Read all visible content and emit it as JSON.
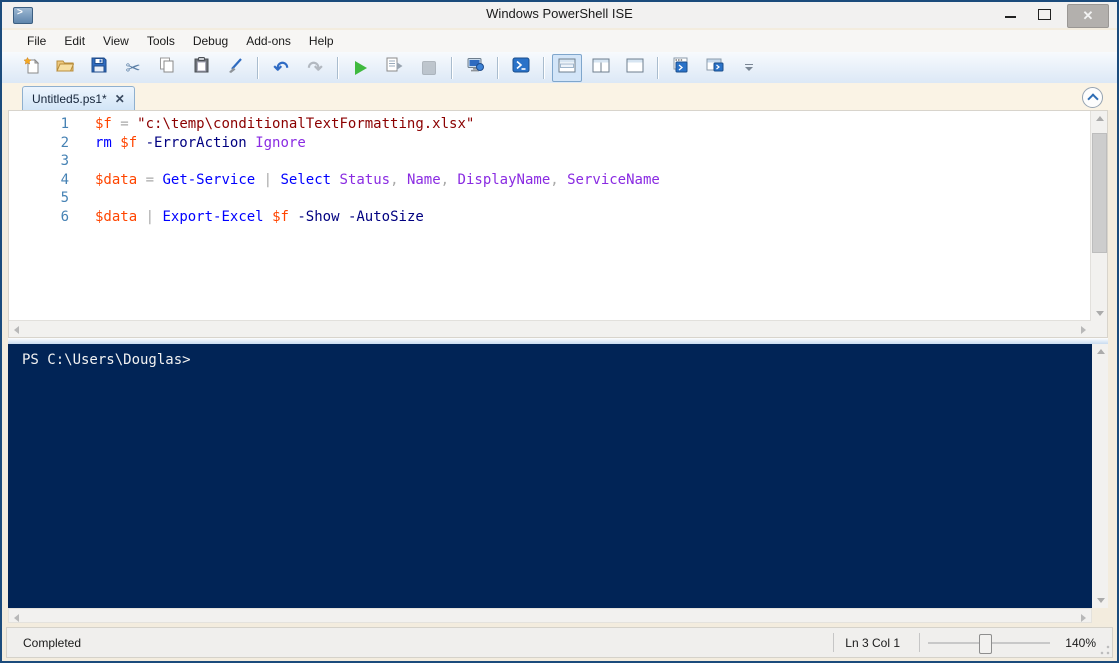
{
  "window": {
    "title": "Windows PowerShell ISE",
    "controls": {
      "minimize": "minimize",
      "maximize": "maximize",
      "close": "✕"
    }
  },
  "menu": {
    "items": [
      "File",
      "Edit",
      "View",
      "Tools",
      "Debug",
      "Add-ons",
      "Help"
    ]
  },
  "toolbar": {
    "icons": [
      "new-script-icon",
      "open-folder-icon",
      "save-icon",
      "scissors-cut-icon",
      "copy-icon",
      "paste-clipboard-icon",
      "clear-console-icon",
      "undo-arrow-icon",
      "redo-arrow-icon",
      "run-script-play-icon",
      "run-selection-icon",
      "stop-operation-icon",
      "new-remote-powershell-tab-icon",
      "start-powershell-icon",
      "script-pane-top-layout-icon",
      "script-pane-right-layout-icon",
      "script-pane-maximized-layout-icon",
      "new-powershell-tab-icon",
      "powershell-window-icon",
      "toolbar-overflow-icon"
    ],
    "selected_layout": "script-pane-top"
  },
  "tab": {
    "label": "Untitled5.ps1*",
    "close_glyph": "✕"
  },
  "editor": {
    "lines": [
      {
        "num": "1",
        "tokens": [
          {
            "t": "$f",
            "c": "variable"
          },
          {
            "t": " ",
            "c": "plain"
          },
          {
            "t": "=",
            "c": "operator"
          },
          {
            "t": " ",
            "c": "plain"
          },
          {
            "t": "\"c:\\temp\\conditionalTextFormatting.xlsx\"",
            "c": "string"
          }
        ]
      },
      {
        "num": "2",
        "tokens": [
          {
            "t": "rm",
            "c": "command"
          },
          {
            "t": " ",
            "c": "plain"
          },
          {
            "t": "$f",
            "c": "variable"
          },
          {
            "t": " ",
            "c": "plain"
          },
          {
            "t": "-ErrorAction",
            "c": "parameter"
          },
          {
            "t": " ",
            "c": "plain"
          },
          {
            "t": "Ignore",
            "c": "argument"
          }
        ]
      },
      {
        "num": "3",
        "tokens": []
      },
      {
        "num": "4",
        "tokens": [
          {
            "t": "$data",
            "c": "variable"
          },
          {
            "t": " ",
            "c": "plain"
          },
          {
            "t": "=",
            "c": "operator"
          },
          {
            "t": " ",
            "c": "plain"
          },
          {
            "t": "Get-Service",
            "c": "command"
          },
          {
            "t": " ",
            "c": "plain"
          },
          {
            "t": "|",
            "c": "operator"
          },
          {
            "t": " ",
            "c": "plain"
          },
          {
            "t": "Select",
            "c": "command"
          },
          {
            "t": " ",
            "c": "plain"
          },
          {
            "t": "Status",
            "c": "argument"
          },
          {
            "t": ", ",
            "c": "operator"
          },
          {
            "t": "Name",
            "c": "argument"
          },
          {
            "t": ", ",
            "c": "operator"
          },
          {
            "t": "DisplayName",
            "c": "argument"
          },
          {
            "t": ", ",
            "c": "operator"
          },
          {
            "t": "ServiceName",
            "c": "argument"
          }
        ]
      },
      {
        "num": "5",
        "tokens": []
      },
      {
        "num": "6",
        "tokens": [
          {
            "t": "$data",
            "c": "variable"
          },
          {
            "t": " ",
            "c": "plain"
          },
          {
            "t": "|",
            "c": "operator"
          },
          {
            "t": " ",
            "c": "plain"
          },
          {
            "t": "Export-Excel",
            "c": "command"
          },
          {
            "t": " ",
            "c": "plain"
          },
          {
            "t": "$f",
            "c": "variable"
          },
          {
            "t": " ",
            "c": "plain"
          },
          {
            "t": "-Show",
            "c": "parameter"
          },
          {
            "t": " ",
            "c": "plain"
          },
          {
            "t": "-AutoSize",
            "c": "parameter"
          }
        ]
      }
    ],
    "token_colors": {
      "variable": "#FF4500",
      "operator": "#A9A9A9",
      "string": "#8B0000",
      "command": "#0000FF",
      "parameter": "#000080",
      "argument": "#8A2BE2",
      "line_number": "#4682B4"
    }
  },
  "console": {
    "prompt": "PS C:\\Users\\Douglas>",
    "background": "#012456",
    "foreground": "#F2F2F2"
  },
  "status": {
    "state": "Completed",
    "position": "Ln 3  Col 1",
    "zoom_label": "140%"
  }
}
